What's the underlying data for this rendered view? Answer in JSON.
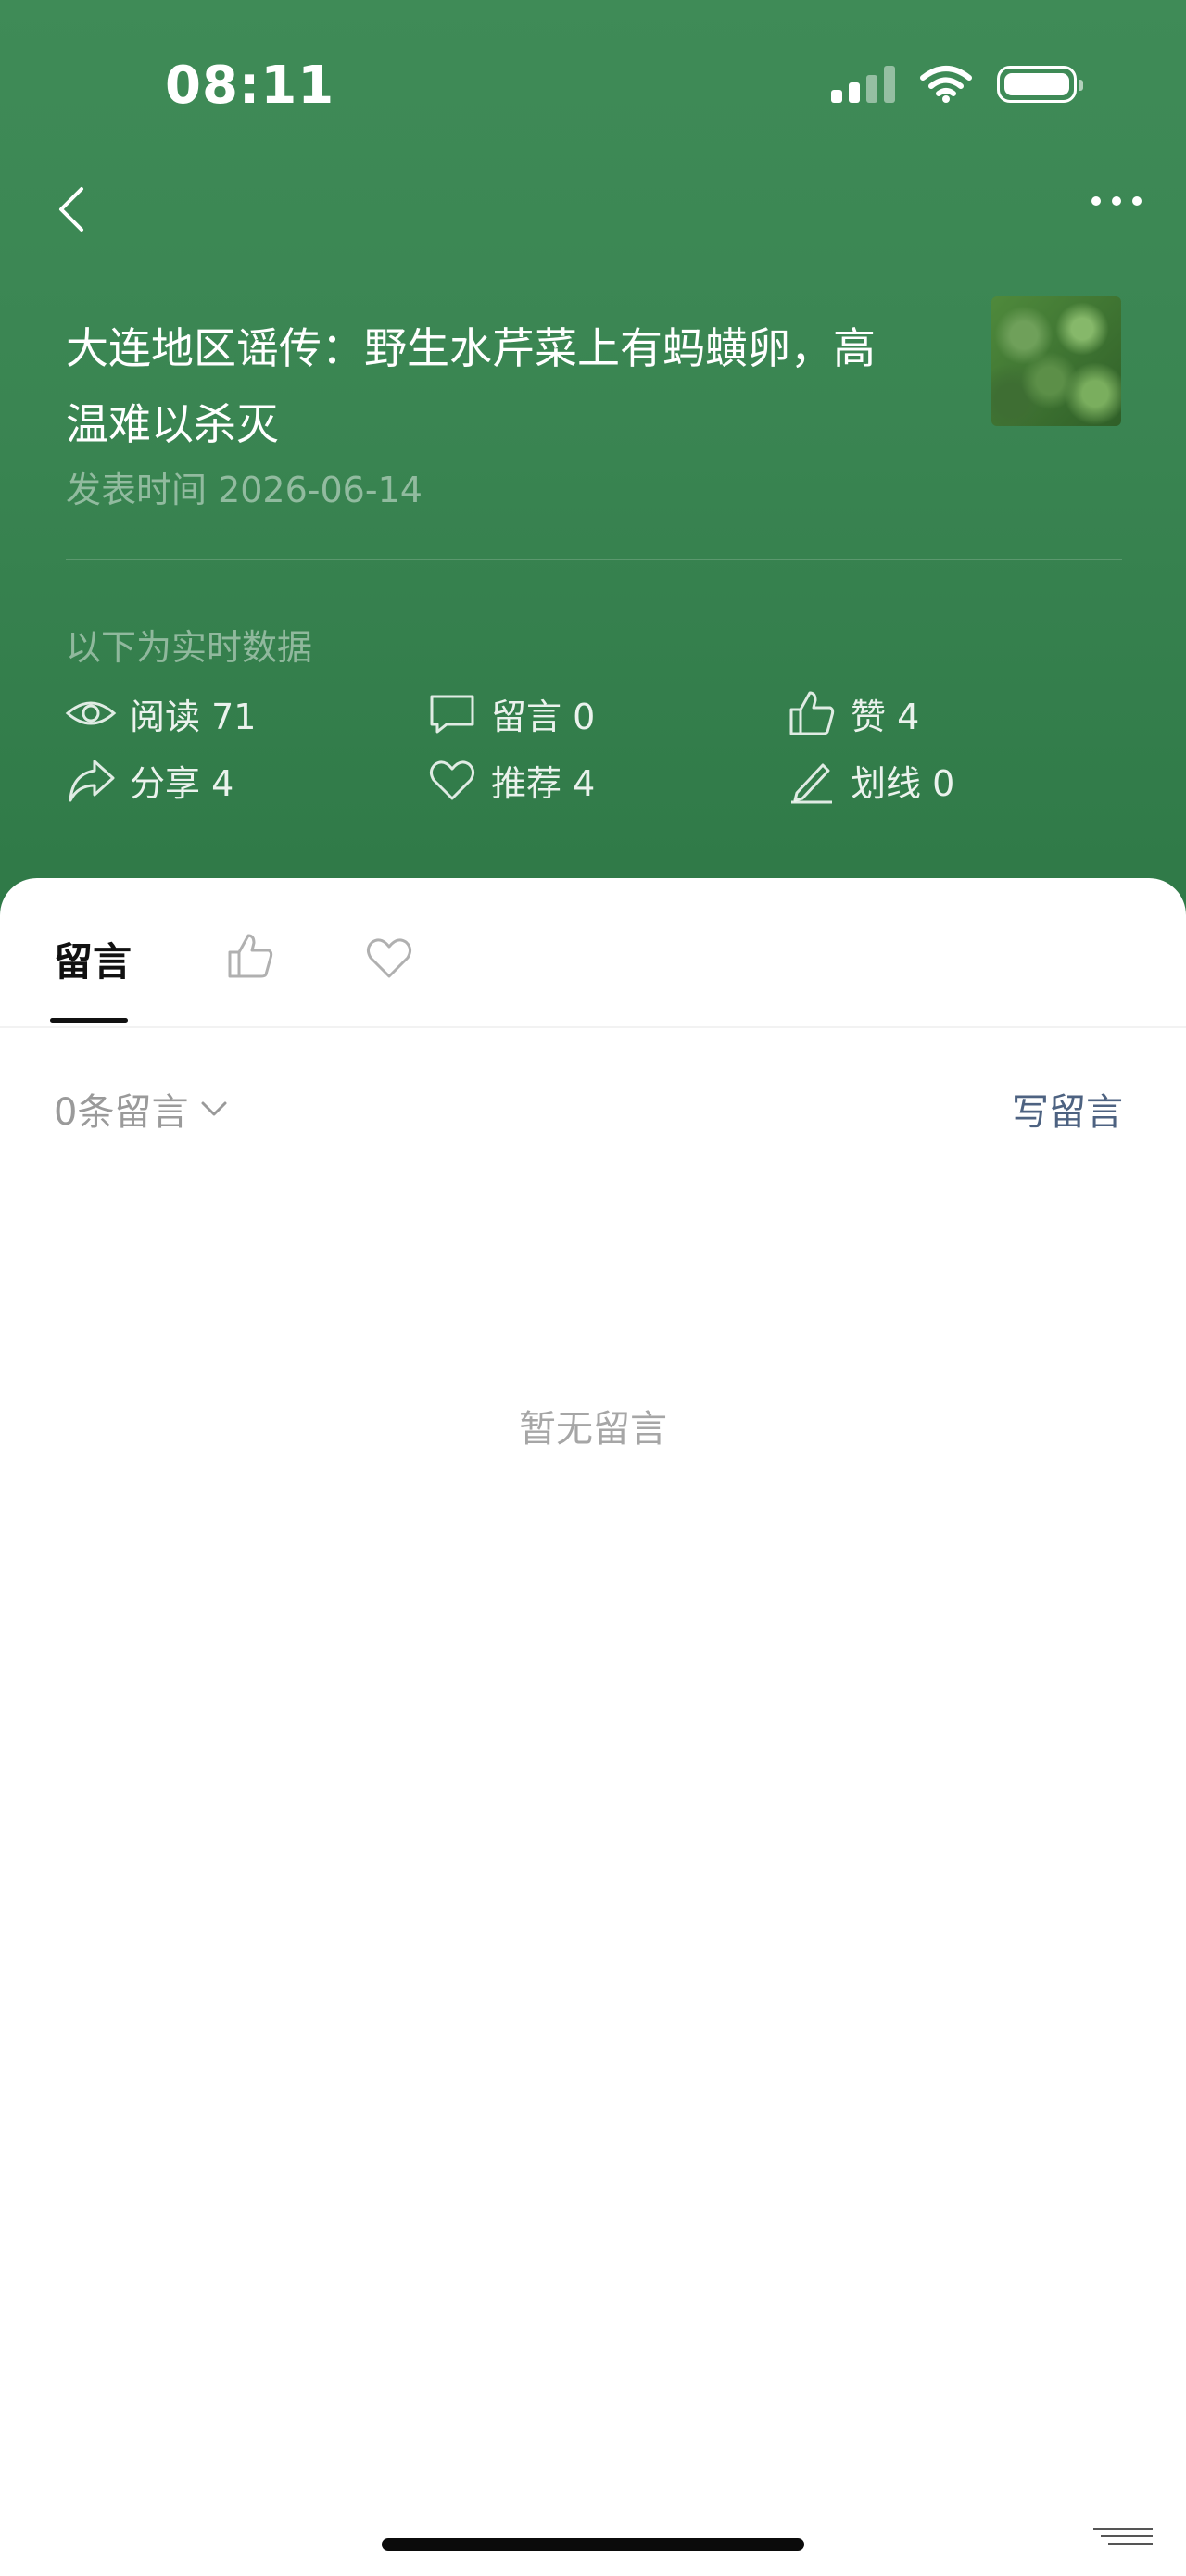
{
  "status_bar": {
    "time": "08:11"
  },
  "nav": {
    "back_icon": "chevron-left-icon",
    "more_icon": "more-dots-icon"
  },
  "article": {
    "title": "大连地区谣传：野生水芹菜上有蚂蟥卵，高温难以杀灭",
    "publish_time": "发表时间 2026-06-14",
    "thumbnail": "water-celery-thumbnail"
  },
  "stats": {
    "label": "以下为实时数据",
    "reads": "阅读 71",
    "comments": "留言 0",
    "likes": "赞 4",
    "shares": "分享 4",
    "recommends": "推荐 4",
    "underlines": "划线 0"
  },
  "tabs": {
    "comments_label": "留言",
    "likes_icon": "thumbs-up-icon",
    "recommends_icon": "heart-icon"
  },
  "comments": {
    "count_label": "0条留言",
    "write_label": "写留言",
    "empty_label": "暂无留言"
  }
}
